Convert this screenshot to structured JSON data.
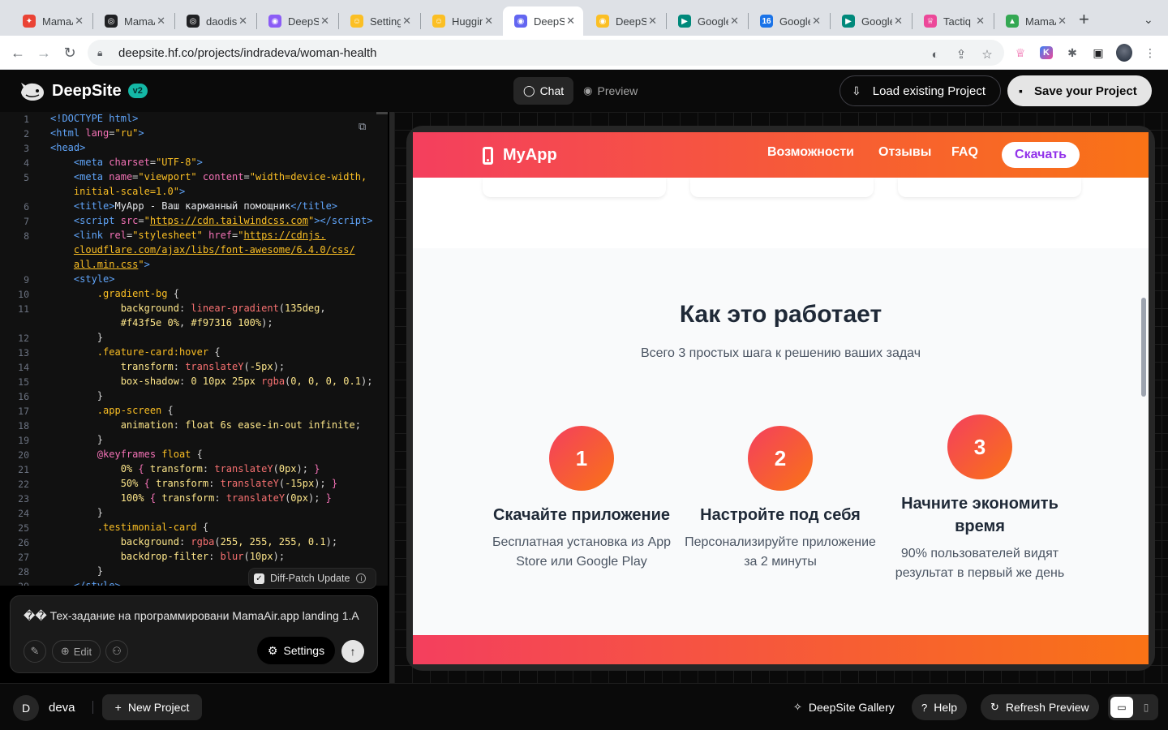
{
  "browser": {
    "tabs": [
      {
        "title": "MamaAir",
        "color": "#ea4335",
        "glyph": "✦"
      },
      {
        "title": "MamaAir",
        "color": "#202124",
        "glyph": "◎"
      },
      {
        "title": "daodis",
        "color": "#202124",
        "glyph": "◎"
      },
      {
        "title": "DeepSite",
        "color": "#8b5cf6",
        "glyph": "◉"
      },
      {
        "title": "Settings",
        "color": "#fbbf24",
        "glyph": "☺"
      },
      {
        "title": "Hugging",
        "color": "#fbbf24",
        "glyph": "☺"
      },
      {
        "title": "DeepSite",
        "color": "#6366f1",
        "glyph": "◉",
        "active": true
      },
      {
        "title": "DeepSite",
        "color": "#fbbf24",
        "glyph": "◉"
      },
      {
        "title": "Google Meet",
        "color": "#00897b",
        "glyph": "▶"
      },
      {
        "title": "Google Calendar",
        "color": "#1a73e8",
        "glyph": "16"
      },
      {
        "title": "Google Meet",
        "color": "#00897b",
        "glyph": "▶"
      },
      {
        "title": "Tactiq",
        "color": "#ec4899",
        "glyph": "♕"
      },
      {
        "title": "MamaAir",
        "color": "#34a853",
        "glyph": "▲"
      }
    ],
    "url": "deepsite.hf.co/projects/indradeva/woman-health"
  },
  "app": {
    "name": "DeepSite",
    "badge": "v2",
    "chat_label": "Chat",
    "preview_label": "Preview",
    "load_label": "Load existing Project",
    "save_label": "Save your Project"
  },
  "editor": {
    "line_numbers": [
      "1",
      "2",
      "3",
      "4",
      "5",
      "",
      "6",
      "7",
      "8",
      "",
      "",
      "9",
      "10",
      "11",
      "",
      "12",
      "13",
      "14",
      "15",
      "16",
      "17",
      "18",
      "19",
      "20",
      "21",
      "22",
      "23",
      "24",
      "25",
      "26",
      "27",
      "28",
      "29"
    ],
    "diff_patch_label": "Diff-Patch Update"
  },
  "prompt": {
    "text": "�� Тех-задание на программировани MamaAir.app landing 1.А",
    "edit_label": "Edit",
    "settings_label": "Settings"
  },
  "preview": {
    "brand": "MyApp",
    "nav_links": [
      "Возможности",
      "Отзывы",
      "FAQ"
    ],
    "cta": "Скачать",
    "section_title": "Как это работает",
    "section_subtitle": "Всего 3 простых шага к решению ваших задач",
    "steps": [
      {
        "num": "1",
        "title": "Скачайте приложение",
        "desc": "Бесплатная установка из App Store или Google Play"
      },
      {
        "num": "2",
        "title": "Настройте под себя",
        "desc": "Персонализируйте приложение за 2 минуты"
      },
      {
        "num": "3",
        "title": "Начните экономить время",
        "desc": "90% пользователей видят результат в первый же день"
      }
    ]
  },
  "bottom": {
    "avatar_initial": "D",
    "username": "deva",
    "new_project": "New Project",
    "gallery": "DeepSite Gallery",
    "help": "Help",
    "refresh": "Refresh Preview"
  },
  "colors": {
    "brand_gradient_start": "#f43f5e",
    "brand_gradient_end": "#f97316",
    "cta_text": "#9333ea",
    "badge": "#14b8a6"
  }
}
